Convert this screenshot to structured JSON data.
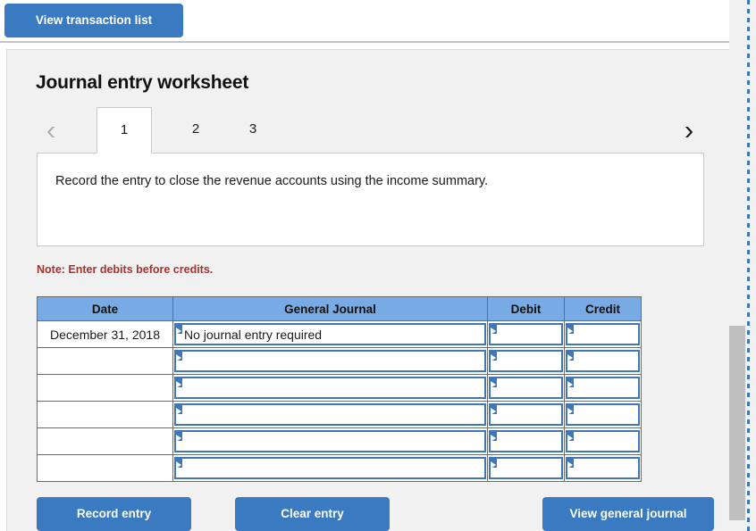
{
  "top_bar": {
    "view_transaction_list_label": "View transaction list"
  },
  "worksheet": {
    "title": "Journal entry worksheet",
    "tabs": [
      {
        "label": "1",
        "active": true
      },
      {
        "label": "2",
        "active": false
      },
      {
        "label": "3",
        "active": false
      }
    ],
    "prev_arrow_icon": "chevron-left-icon",
    "next_arrow_icon": "chevron-right-icon",
    "description": "Record the entry to close the revenue accounts using the income summary.",
    "note": "Note: Enter debits before credits."
  },
  "table": {
    "headers": [
      "Date",
      "General Journal",
      "Debit",
      "Credit"
    ],
    "rows": [
      {
        "date": "December 31, 2018",
        "general_journal": "No journal entry required",
        "debit": "",
        "credit": ""
      },
      {
        "date": "",
        "general_journal": "",
        "debit": "",
        "credit": ""
      },
      {
        "date": "",
        "general_journal": "",
        "debit": "",
        "credit": ""
      },
      {
        "date": "",
        "general_journal": "",
        "debit": "",
        "credit": ""
      },
      {
        "date": "",
        "general_journal": "",
        "debit": "",
        "credit": ""
      },
      {
        "date": "",
        "general_journal": "",
        "debit": "",
        "credit": ""
      }
    ]
  },
  "actions": {
    "record_entry_label": "Record entry",
    "clear_entry_label": "Clear entry",
    "view_general_journal_label": "View general journal"
  },
  "colors": {
    "button_blue": "#3a7ac0",
    "header_blue": "#78aae4",
    "cell_border_blue": "#3f77b5",
    "note_red": "#a8332e",
    "panel_grey": "#f1f1f1"
  }
}
